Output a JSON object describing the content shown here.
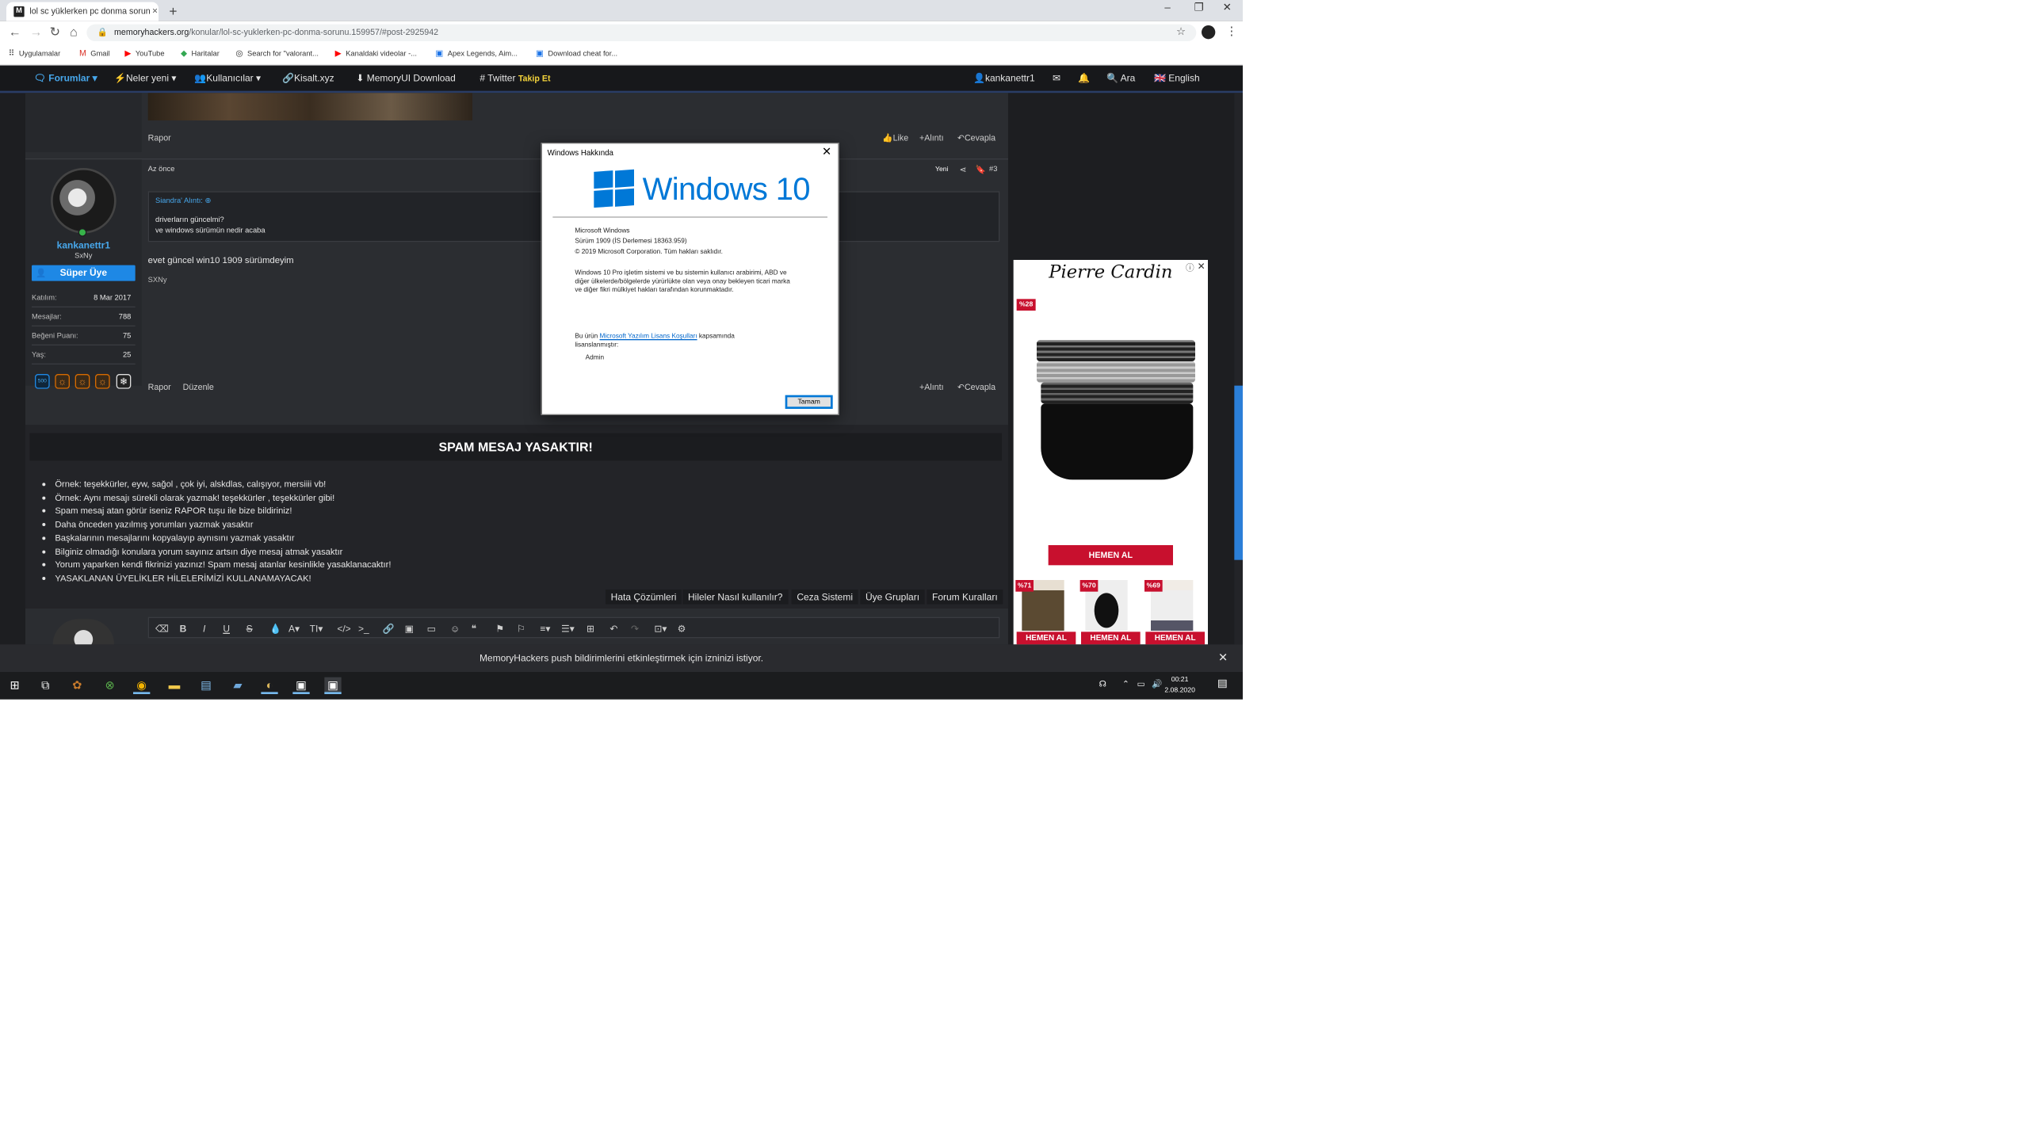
{
  "browser": {
    "tab_title": "lol sc yüklerken pc donma sorun",
    "tab_close": "×",
    "new_tab": "+",
    "url_host": "memoryhackers.org",
    "url_path": "/konular/lol-sc-yuklerken-pc-donma-sorunu.159957/#post-2925942",
    "window_controls": {
      "minimize": "–",
      "restore": "❐",
      "close": "✕"
    },
    "bookmarks": [
      {
        "icon": "apps-icon",
        "label": "Uygulamalar"
      },
      {
        "icon": "gmail-icon",
        "label": "Gmail"
      },
      {
        "icon": "youtube-icon",
        "label": "YouTube"
      },
      {
        "icon": "maps-icon",
        "label": "Haritalar"
      },
      {
        "icon": "search-icon",
        "label": "Search for \"valorant..."
      },
      {
        "icon": "youtube-icon",
        "label": "Kanaldaki videolar -..."
      },
      {
        "icon": "page-icon",
        "label": "Apex Legends, Aim..."
      },
      {
        "icon": "page-icon",
        "label": "Download cheat for..."
      }
    ]
  },
  "nav": {
    "forums": "Forumlar",
    "whats_new": "Neler yeni",
    "members": "Kullanıcılar",
    "kisalt": "Kisalt.xyz",
    "memoryui": "MemoryUI Download",
    "twitter": "Twitter",
    "follow": "Takip Et",
    "username": "kankanettr1",
    "search": "Ara",
    "language": "English"
  },
  "prev_post": {
    "report": "Rapor",
    "like": "Like",
    "quote": "Alıntı",
    "reply": "Cevapla"
  },
  "post": {
    "time": "Az önce",
    "new_label": "Yeni",
    "number": "#3",
    "quote_author": "Siandra' Alıntı:",
    "quote_lines": [
      "driverların güncelmi?",
      "ve windows sürümün nedir acaba"
    ],
    "body": "evet güncel win10 1909 sürümdeyim",
    "signature": "SXNy",
    "report": "Rapor",
    "edit": "Düzenle",
    "quote": "Alıntı",
    "reply": "Cevapla"
  },
  "user": {
    "name": "kankanettr1",
    "title": "SxNy",
    "badge": "Süper Üye",
    "stats": [
      {
        "label": "Katılım:",
        "value": "8 Mar 2017"
      },
      {
        "label": "Mesajlar:",
        "value": "788"
      },
      {
        "label": "Beğeni Puanı:",
        "value": "75"
      },
      {
        "label": "Yaş:",
        "value": "25"
      }
    ],
    "trophies": [
      "500",
      "☼",
      "☼",
      "☼",
      "❄"
    ]
  },
  "rules": {
    "title": "SPAM MESAJ YASAKTIR!",
    "items": [
      "Örnek: teşekkürler, eyw, sağol , çok iyi, alskdlas, calışıyor, mersiiii vb!",
      "Örnek: Aynı mesajı sürekli olarak yazmak! teşekkürler , teşekkürler gibi!",
      "Spam mesaj atan görür iseniz RAPOR tuşu ile bize bildiriniz!",
      "Daha önceden yazılmış yorumları yazmak yasaktır",
      "Başkalarının mesajlarını kopyalayıp aynısını yazmak yasaktır",
      "Bilginiz olmadığı konulara yorum sayınız artsın diye mesaj atmak yasaktır",
      "Yorum yaparken kendi fikrinizi yazınız! Spam mesaj atanlar kesinlikle yasaklanacaktır!",
      "YASAKLANAN ÜYELİKLER HİLELERİMİZİ KULLANAMAYACAK!"
    ],
    "links": [
      "Hata Çözümleri",
      "Hileler Nasıl kullanılır?",
      "Ceza Sistemi",
      "Üye Grupları",
      "Forum Kuralları"
    ]
  },
  "editor_tools": [
    "eraser-icon",
    "bold-icon",
    "italic-icon",
    "underline-icon",
    "strike-icon",
    "color-icon",
    "font-icon",
    "size-icon",
    "code-icon",
    "terminal-icon",
    "link-icon",
    "image-icon",
    "video-icon",
    "emoji-icon",
    "quote-icon",
    "flag-icon",
    "flag2-icon",
    "align-icon",
    "list-icon",
    "table-icon",
    "undo-icon",
    "redo-icon",
    "more-icon",
    "settings-icon"
  ],
  "dialog": {
    "title": "Windows Hakkında",
    "close": "✕",
    "product": "Windows 10",
    "line1": "Microsoft Windows",
    "line2": "Sürüm 1909 (İS Derlemesi 18363.959)",
    "line3": "© 2019 Microsoft Corporation. Tüm hakları saklıdır.",
    "legal1": "Windows 10 Pro işletim sistemi ve bu sistemin kullanıcı arabirimi, ABD ve",
    "legal2": "diğer ülkelerde/bölgelerde yürürlükte olan veya onay bekleyen ticari marka",
    "legal3": "ve diğer fikri mülkiyet hakları tarafından korunmaktadır.",
    "license_pre": "Bu ürün",
    "license_link": "Microsoft Yazılım Lisans Koşulları",
    "license_post": "kapsamında",
    "license_line2": "lisanslanmıştır:",
    "licensee": "Admin",
    "ok": "Tamam"
  },
  "ad": {
    "brand": "Pierre Cardin",
    "main_discount": "%28",
    "cta": "HEMEN AL",
    "items": [
      {
        "discount": "%71"
      },
      {
        "discount": "%70"
      },
      {
        "discount": "%69"
      }
    ],
    "accent": "#c8102e"
  },
  "notification": {
    "site": "MemoryHackers",
    "text": "push bildirimlerini etkinleştirmek için izninizi istiyor.",
    "close": "✕"
  },
  "taskbar": {
    "time": "00:21",
    "date": "2.08.2020"
  }
}
